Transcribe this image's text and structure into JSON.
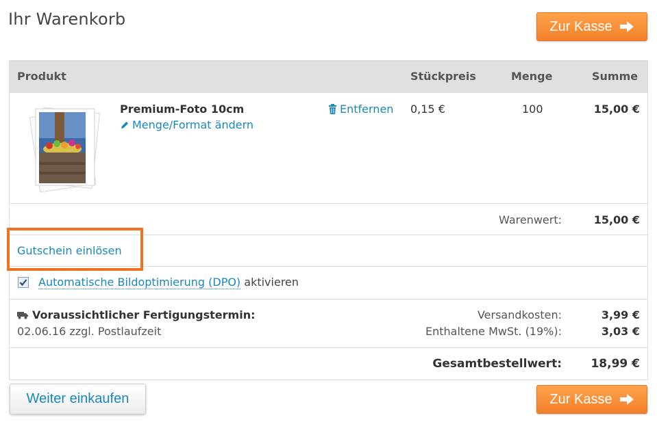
{
  "page": {
    "title": "Ihr Warenkorb"
  },
  "checkout_button": {
    "label": "Zur Kasse"
  },
  "table": {
    "headers": {
      "product": "Produkt",
      "unit_price": "Stückpreis",
      "quantity": "Menge",
      "sum": "Summe"
    }
  },
  "item": {
    "name": "Premium-Foto 10cm",
    "edit_label": "Menge/Format ändern",
    "remove_label": "Entfernen",
    "unit_price": "0,15 €",
    "quantity": "100",
    "sum": "15,00 €"
  },
  "totals": {
    "goods_value_label": "Warenwert:",
    "goods_value": "15,00 €",
    "shipping_label": "Versandkosten:",
    "shipping": "3,99 €",
    "vat_label": "Enthaltene MwSt. (19%):",
    "vat": "3,03 €",
    "grand_total_label": "Gesamtbestellwert:",
    "grand_total": "18,99 €"
  },
  "coupon": {
    "label": "Gutschein einlösen"
  },
  "dpo": {
    "checked": true,
    "link_label": "Automatische Bildoptimierung (DPO)",
    "suffix": "aktivieren"
  },
  "delivery": {
    "title": "Voraussichtlicher Fertigungstermin:",
    "date_text": "02.06.16 zzgl. Postlaufzeit"
  },
  "continue_button": {
    "label": "Weiter einkaufen"
  },
  "colors": {
    "accent_orange": "#f3812a",
    "link_blue": "#1b87b8",
    "header_gray": "#e0e0e0",
    "highlight_border": "#f07122"
  }
}
